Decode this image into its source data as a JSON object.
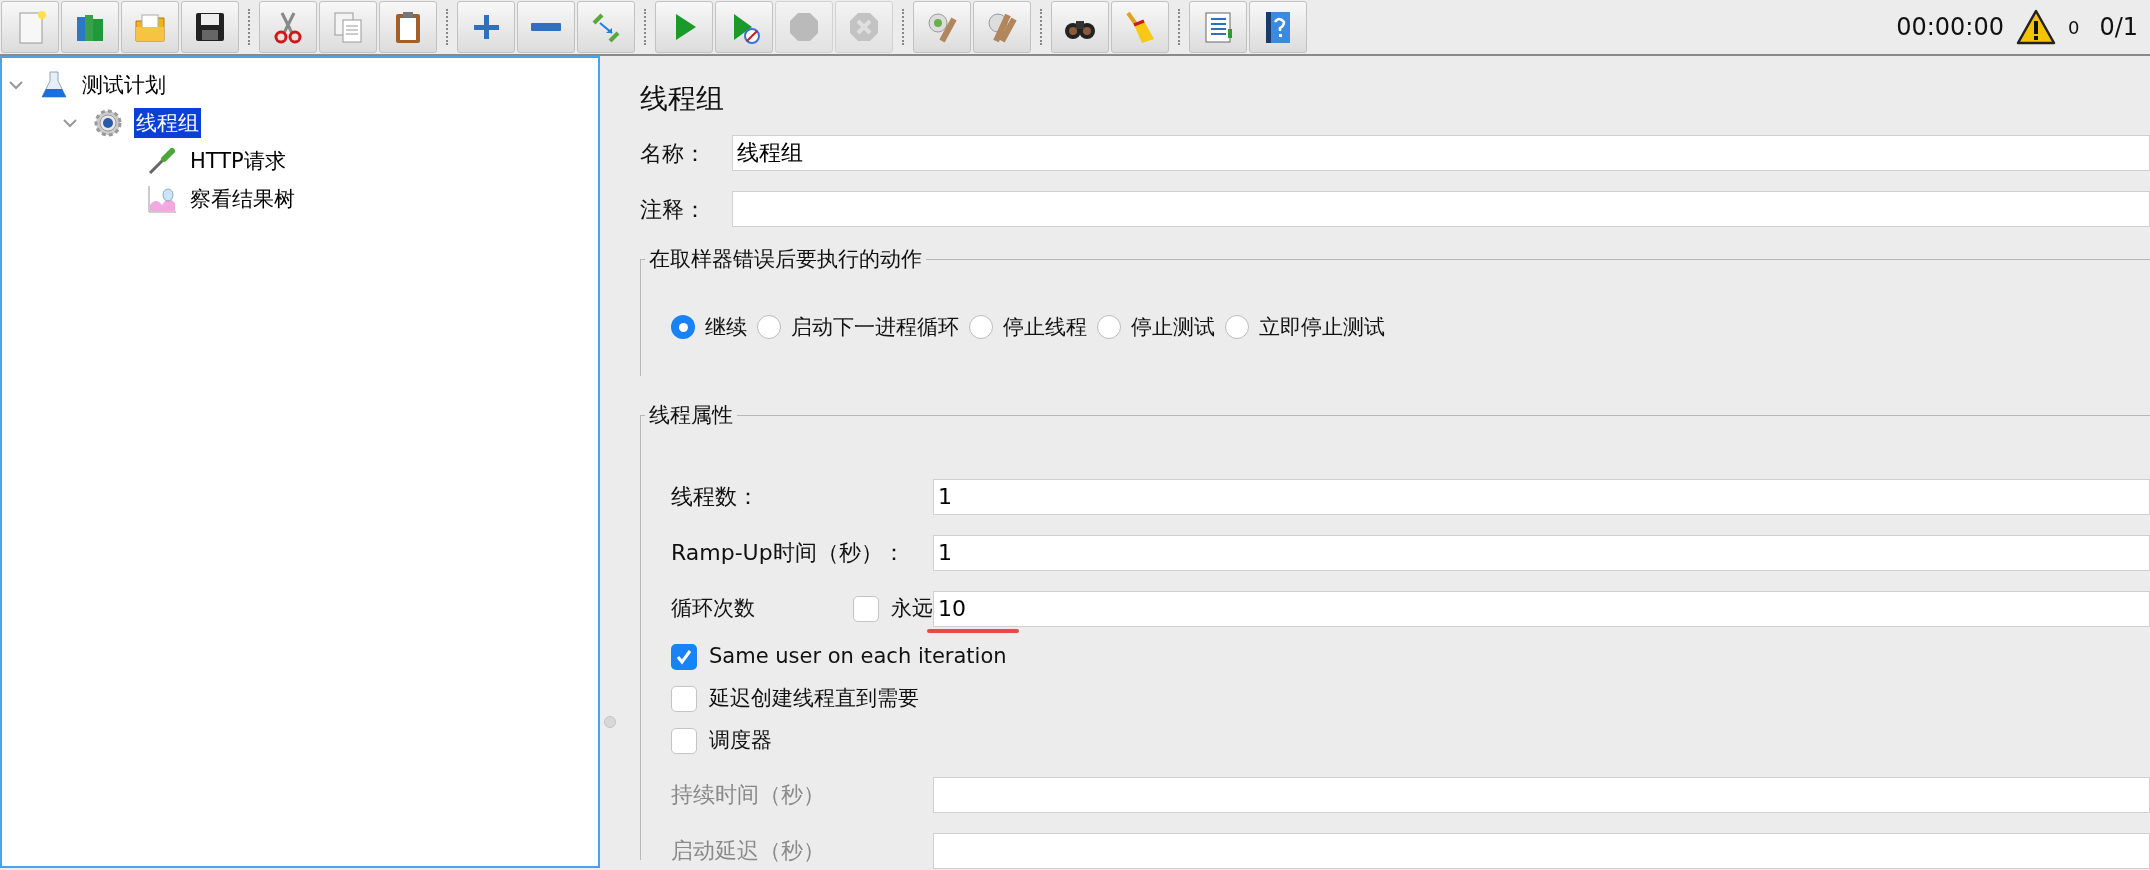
{
  "toolbar": {
    "groups": [
      [
        {
          "kind": "new",
          "disabled": false
        },
        {
          "kind": "templates",
          "disabled": false
        },
        {
          "kind": "open",
          "disabled": false
        },
        {
          "kind": "save",
          "disabled": false
        }
      ],
      [
        {
          "kind": "cut",
          "disabled": false
        },
        {
          "kind": "copy",
          "disabled": false
        },
        {
          "kind": "paste",
          "disabled": false
        }
      ],
      [
        {
          "kind": "expand",
          "disabled": false
        },
        {
          "kind": "collapse",
          "disabled": false
        },
        {
          "kind": "toggle",
          "disabled": false
        }
      ],
      [
        {
          "kind": "start",
          "disabled": false
        },
        {
          "kind": "startnopause",
          "disabled": false
        },
        {
          "kind": "stop",
          "disabled": true
        },
        {
          "kind": "shutdown",
          "disabled": true
        }
      ],
      [
        {
          "kind": "clear",
          "disabled": false
        },
        {
          "kind": "clearall",
          "disabled": false
        }
      ],
      [
        {
          "kind": "search",
          "disabled": false
        },
        {
          "kind": "reset",
          "disabled": false
        }
      ],
      [
        {
          "kind": "functions",
          "disabled": false
        },
        {
          "kind": "help",
          "disabled": false
        }
      ]
    ],
    "timer": "00:00:00",
    "warnings": "0",
    "threads": "0/1"
  },
  "tree": [
    {
      "label": "测试计划",
      "kind": "plan",
      "expanded": true,
      "selected": false,
      "children": [
        {
          "label": "线程组",
          "kind": "threadgroup",
          "expanded": true,
          "selected": true,
          "children": [
            {
              "label": "HTTP请求",
              "kind": "sampler",
              "selected": false
            },
            {
              "label": "察看结果树",
              "kind": "listener",
              "selected": false
            }
          ]
        }
      ]
    }
  ],
  "panel": {
    "title": "线程组",
    "name": {
      "label": "名称：",
      "value": "线程组"
    },
    "comment": {
      "label": "注释："
    },
    "error_action": {
      "legend": "在取样器错误后要执行的动作",
      "options": [
        {
          "label": "继续",
          "selected": true
        },
        {
          "label": "启动下一进程循环",
          "selected": false
        },
        {
          "label": "停止线程",
          "selected": false
        },
        {
          "label": "停止测试",
          "selected": false
        },
        {
          "label": "立即停止测试",
          "selected": false
        }
      ]
    },
    "thread_properties": {
      "legend": "线程属性",
      "threads": {
        "label": "线程数：",
        "value": "1"
      },
      "ramp_up": {
        "label": "Ramp-Up时间（秒）：",
        "value": "1"
      },
      "loop": {
        "label": "循环次数",
        "forever_label": "永远",
        "forever": false,
        "value": "10",
        "underlined": true
      },
      "options": [
        {
          "label": "Same user on each iteration",
          "checked": true
        },
        {
          "label": "延迟创建线程直到需要",
          "checked": false
        },
        {
          "label": "调度器",
          "checked": false
        }
      ],
      "duration": {
        "label": "持续时间（秒）",
        "disabled": true
      },
      "startup_delay": {
        "label": "启动延迟（秒）",
        "disabled": true
      }
    }
  }
}
